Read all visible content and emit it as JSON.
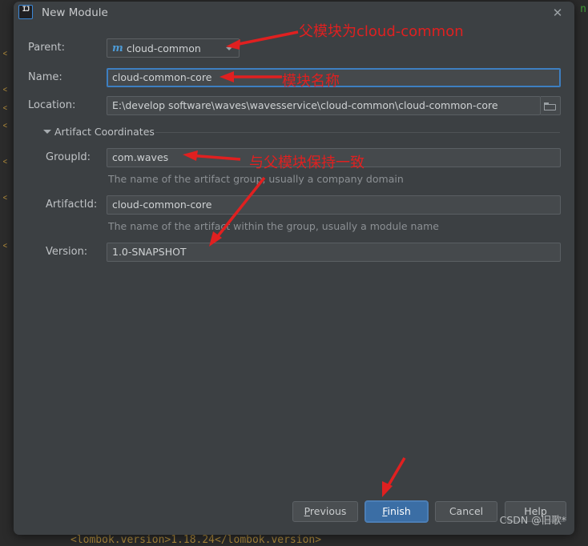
{
  "background": {
    "carets": [
      "<",
      "<",
      "<",
      "<",
      "<",
      "<",
      "<"
    ],
    "green_fragment": "n",
    "bottom_code": "<lombok.version>1.18.24</lombok.version>"
  },
  "dialog": {
    "title": "New Module",
    "app_icon": "intellij-idea-icon",
    "close_icon": "close-icon"
  },
  "form": {
    "parent": {
      "label": "Parent:",
      "value": "cloud-common",
      "icon": "maven-module-icon",
      "dropdown_icon": "chevron-down-icon"
    },
    "name": {
      "label": "Name:",
      "value": "cloud-common-core"
    },
    "location": {
      "label": "Location:",
      "value": "E:\\develop software\\waves\\wavesservice\\cloud-common\\cloud-common-core",
      "browse_icon": "folder-icon"
    }
  },
  "artifact_section": {
    "title": "Artifact Coordinates",
    "expanded": true,
    "collapse_icon": "triangle-down-icon",
    "group_id": {
      "label": "GroupId:",
      "value": "com.waves",
      "hint": "The name of the artifact group, usually a company domain"
    },
    "artifact_id": {
      "label": "ArtifactId:",
      "value": "cloud-common-core",
      "hint": "The name of the artifact within the group, usually a module name"
    },
    "version": {
      "label": "Version:",
      "value": "1.0-SNAPSHOT"
    }
  },
  "buttons": {
    "previous": {
      "label": "Previous",
      "mnemonic": "P"
    },
    "finish": {
      "label": "Finish",
      "mnemonic": "F",
      "primary": true
    },
    "cancel": {
      "label": "Cancel"
    },
    "help": {
      "label": "Help"
    }
  },
  "annotations": [
    {
      "text": "父模块为cloud-common",
      "target": "parent-field"
    },
    {
      "text": "模块名称",
      "target": "name-field"
    },
    {
      "text": "与父模块保持一致",
      "target": "group-id-field"
    }
  ],
  "watermark": {
    "text": "CSDN @旧歌*"
  },
  "colors": {
    "dialog_bg": "#3c4043",
    "field_bg": "#45494c",
    "focus_border": "#3d7fc1",
    "primary_button": "#3b6ea5",
    "annotation_red": "#e02020",
    "label_text": "#bfc2c5",
    "hint_text": "#8c9094",
    "code_yellow": "#a9863a",
    "code_green": "#3f9c35"
  }
}
